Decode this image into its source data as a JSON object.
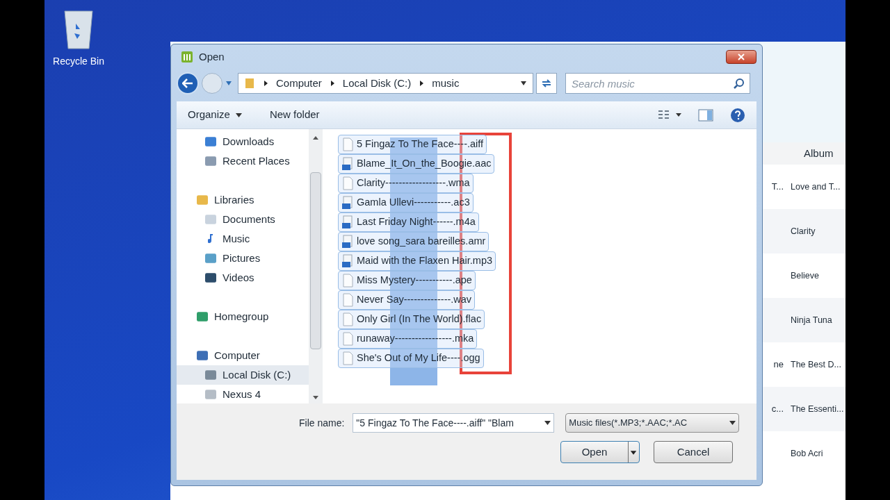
{
  "desktop": {
    "icons": [
      {
        "label": "Recycle Bin"
      }
    ]
  },
  "background_window": {
    "columns": [
      "Album"
    ],
    "rows": [
      {
        "column_1": "T...",
        "album": "Love and T..."
      },
      {
        "album": "Clarity"
      },
      {
        "album": "Believe"
      },
      {
        "album": "Ninja Tuna"
      },
      {
        "column_1": "ne",
        "album": "The Best D..."
      },
      {
        "column_1": "c...",
        "album": "The Essenti..."
      },
      {
        "album": "Bob Acri"
      }
    ]
  },
  "dialog": {
    "title": "Open",
    "breadcrumb": [
      "Computer",
      "Local Disk (C:)",
      "music"
    ],
    "search": {
      "placeholder": "Search music"
    },
    "toolbar": [
      "Organize",
      "New folder"
    ],
    "nav": [
      {
        "children": [
          {
            "label": "Downloads",
            "kind": "downloads",
            "selected": false
          },
          {
            "label": "Recent Places",
            "kind": "recent",
            "selected": false
          }
        ]
      },
      {
        "label": "Libraries",
        "kind": "libraries",
        "selected": false,
        "children": [
          {
            "label": "Documents",
            "kind": "documents",
            "selected": false
          },
          {
            "label": "Music",
            "kind": "music",
            "selected": false
          },
          {
            "label": "Pictures",
            "kind": "pictures",
            "selected": false
          },
          {
            "label": "Videos",
            "kind": "videos",
            "selected": false
          }
        ]
      },
      {
        "label": "Homegroup",
        "kind": "homegroup",
        "selected": false
      },
      {
        "label": "Computer",
        "kind": "computer",
        "selected": false,
        "children": [
          {
            "label": "Local Disk (C:)",
            "kind": "disk",
            "selected": true
          },
          {
            "label": "Nexus 4",
            "kind": "phone",
            "selected": false
          }
        ]
      }
    ],
    "files": [
      {
        "name": "5 Fingaz To The Face----.aiff",
        "kind": "blank",
        "selected": true
      },
      {
        "name": "Blame_It_On_the_Boogie.aac",
        "kind": "audio",
        "selected": true
      },
      {
        "name": "Clarity------------------.wma",
        "kind": "blank",
        "selected": true
      },
      {
        "name": "Gamla Ullevi-----------.ac3",
        "kind": "audio",
        "selected": true
      },
      {
        "name": "Last Friday Night------.m4a",
        "kind": "audio",
        "selected": true
      },
      {
        "name": "love song_sara bareilles.amr",
        "kind": "audio",
        "selected": true
      },
      {
        "name": "Maid with the Flaxen Hair.mp3",
        "kind": "audio",
        "selected": true
      },
      {
        "name": "Miss Mystery-----------.ape",
        "kind": "blank",
        "selected": true
      },
      {
        "name": "Never Say--------------.wav",
        "kind": "blank",
        "selected": true
      },
      {
        "name": "Only Girl (In The World).flac",
        "kind": "blank",
        "selected": true
      },
      {
        "name": "runaway-----------------.mka",
        "kind": "blank",
        "selected": true
      },
      {
        "name": "She's Out of My Life----.ogg",
        "kind": "blank",
        "selected": true
      }
    ],
    "file_name": {
      "label": "File name:",
      "value": "\"5 Fingaz To The Face----.aiff\" \"Blam"
    },
    "file_type": "Music files(*.MP3;*.AAC;*.AC",
    "buttons": [
      "Open",
      "Cancel"
    ]
  }
}
